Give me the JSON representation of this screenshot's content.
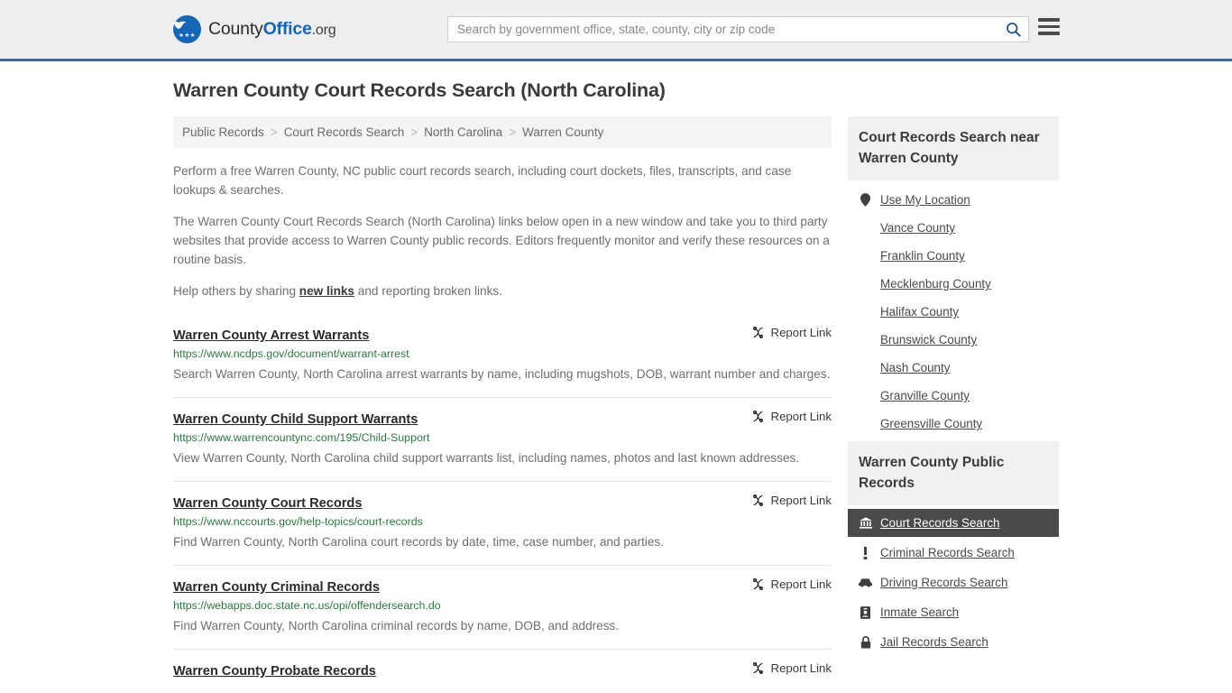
{
  "header": {
    "logo": {
      "part1": "County",
      "part2": "Office",
      "part3": ".org",
      "icon": "eagle-shield-logo",
      "eagle_glyph": "ᾘ5",
      "stars_glyph": "★★★"
    },
    "search": {
      "placeholder": "Search by government office, state, county, city or zip code",
      "value": "",
      "button_icon": "search-icon"
    },
    "menu_icon": "hamburger-menu-icon",
    "accent_color": "#3a6d9e",
    "brand_blue": "#1566b7"
  },
  "page": {
    "title": "Warren County Court Records Search (North Carolina)"
  },
  "breadcrumb": {
    "separator": ">",
    "items": [
      {
        "label": "Public Records"
      },
      {
        "label": "Court Records Search"
      },
      {
        "label": "North Carolina"
      },
      {
        "label": "Warren County"
      }
    ]
  },
  "intro": {
    "p1": "Perform a free Warren County, NC public court records search, including court dockets, files, transcripts, and case lookups & searches.",
    "p2": "The Warren County Court Records Search (North Carolina) links below open in a new window and take you to third party websites that provide access to Warren County public records. Editors frequently monitor and verify these resources on a routine basis.",
    "p3_before": "Help others by sharing ",
    "p3_link": "new links",
    "p3_after": " and reporting broken links."
  },
  "results": {
    "report_label": "Report Link",
    "report_icon": "broken-link-icon",
    "items": [
      {
        "title": "Warren County Arrest Warrants",
        "url": "https://www.ncdps.gov/document/warrant-arrest",
        "description": "Search Warren County, North Carolina arrest warrants by name, including mugshots, DOB, warrant number and charges."
      },
      {
        "title": "Warren County Child Support Warrants",
        "url": "https://www.warrencountync.com/195/Child-Support",
        "description": "View Warren County, North Carolina child support warrants list, including names, photos and last known addresses."
      },
      {
        "title": "Warren County Court Records",
        "url": "https://www.nccourts.gov/help-topics/court-records",
        "description": "Find Warren County, North Carolina court records by date, time, case number, and parties."
      },
      {
        "title": "Warren County Criminal Records",
        "url": "https://webapps.doc.state.nc.us/opi/offendersearch.do",
        "description": "Find Warren County, North Carolina criminal records by name, DOB, and address."
      },
      {
        "title": "Warren County Probate Records",
        "url": "",
        "description": ""
      }
    ]
  },
  "sidebar": {
    "nearby": {
      "heading": "Court Records Search near Warren County",
      "items": [
        {
          "label": "Use My Location",
          "icon": "map-pin-icon"
        },
        {
          "label": "Vance County",
          "icon": ""
        },
        {
          "label": "Franklin County",
          "icon": ""
        },
        {
          "label": "Mecklenburg County",
          "icon": ""
        },
        {
          "label": "Halifax County",
          "icon": ""
        },
        {
          "label": "Brunswick County",
          "icon": ""
        },
        {
          "label": "Nash County",
          "icon": ""
        },
        {
          "label": "Granville County",
          "icon": ""
        },
        {
          "label": "Greensville County",
          "icon": ""
        }
      ]
    },
    "public_records": {
      "heading": "Warren County Public Records",
      "items": [
        {
          "label": "Court Records Search",
          "icon": "courthouse-icon",
          "active": true
        },
        {
          "label": "Criminal Records Search",
          "icon": "exclamation-icon",
          "active": false
        },
        {
          "label": "Driving Records Search",
          "icon": "car-icon",
          "active": false
        },
        {
          "label": "Inmate Search",
          "icon": "id-badge-icon",
          "active": false
        },
        {
          "label": "Jail Records Search",
          "icon": "lock-icon",
          "active": false
        }
      ]
    }
  }
}
